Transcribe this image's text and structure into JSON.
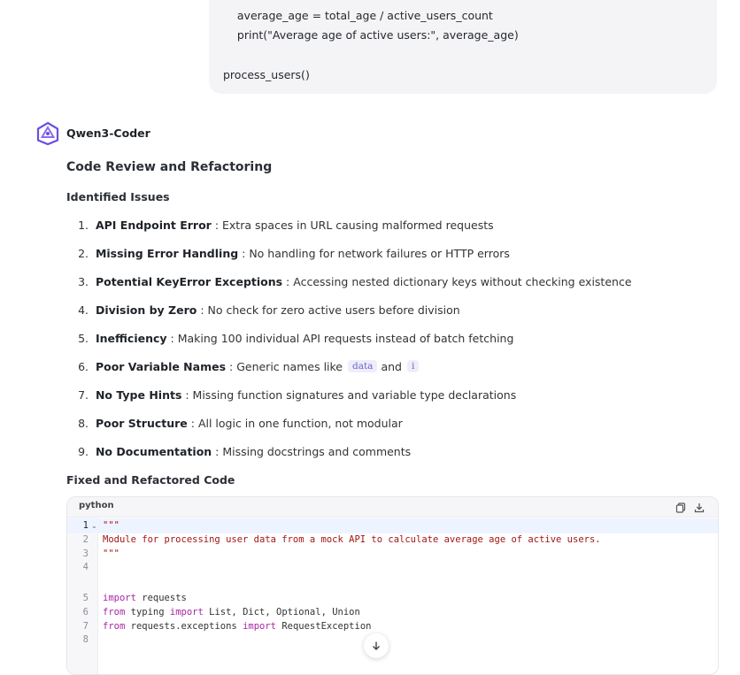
{
  "user_message": {
    "lines": [
      "    average_age = total_age / active_users_count",
      "    print(\"Average age of active users:\", average_age)",
      "process_users()"
    ]
  },
  "assistant": {
    "name": "Qwen3-Coder",
    "heading": "Code Review and Refactoring",
    "issues_heading": "Identified Issues",
    "issues": [
      {
        "num": "1.",
        "title": "API Endpoint Error",
        "desc": " : Extra spaces in URL causing malformed requests"
      },
      {
        "num": "2.",
        "title": "Missing Error Handling",
        "desc": " : No handling for network failures or HTTP errors"
      },
      {
        "num": "3.",
        "title": "Potential KeyError Exceptions",
        "desc": " : Accessing nested dictionary keys without checking existence"
      },
      {
        "num": "4.",
        "title": "Division by Zero",
        "desc": " : No check for zero active users before division"
      },
      {
        "num": "5.",
        "title": "Inefficiency",
        "desc": " : Making 100 individual API requests instead of batch fetching"
      },
      {
        "num": "6.",
        "title": "Poor Variable Names",
        "desc": " : Generic names like ",
        "chip1": "data",
        "between": "and",
        "chip2": "i"
      },
      {
        "num": "7.",
        "title": "No Type Hints",
        "desc": " : Missing function signatures and variable type declarations"
      },
      {
        "num": "8.",
        "title": "Poor Structure",
        "desc": " : All logic in one function, not modular"
      },
      {
        "num": "9.",
        "title": "No Documentation",
        "desc": " : Missing docstrings and comments"
      }
    ],
    "code_heading": "Fixed and Refactored Code",
    "code_block": {
      "language": "python",
      "line_numbers": [
        "1",
        "2",
        "3",
        "4",
        "5",
        "6",
        "7",
        "8"
      ],
      "lines": {
        "l1": "\"\"\"",
        "l2": "Module for processing user data from a mock API to calculate average age of active users.",
        "l3": "\"\"\"",
        "l5_kw": "import",
        "l5_rest": " requests",
        "l6_kw1": "from",
        "l6_mid": " typing ",
        "l6_kw2": "import",
        "l6_rest": " List, Dict, Optional, Union",
        "l7_kw1": "from",
        "l7_mid": " requests.exceptions ",
        "l7_kw2": "import",
        "l7_rest": " RequestException"
      }
    }
  },
  "icons": {
    "copy": "copy-icon",
    "download": "download-icon",
    "scroll_down": "arrow-down-icon",
    "fold": "chevron-down-icon",
    "avatar": "qwen-logo-icon"
  },
  "colors": {
    "accent": "#6b4fe0",
    "string": "#a31515",
    "keyword": "#a626a4"
  }
}
